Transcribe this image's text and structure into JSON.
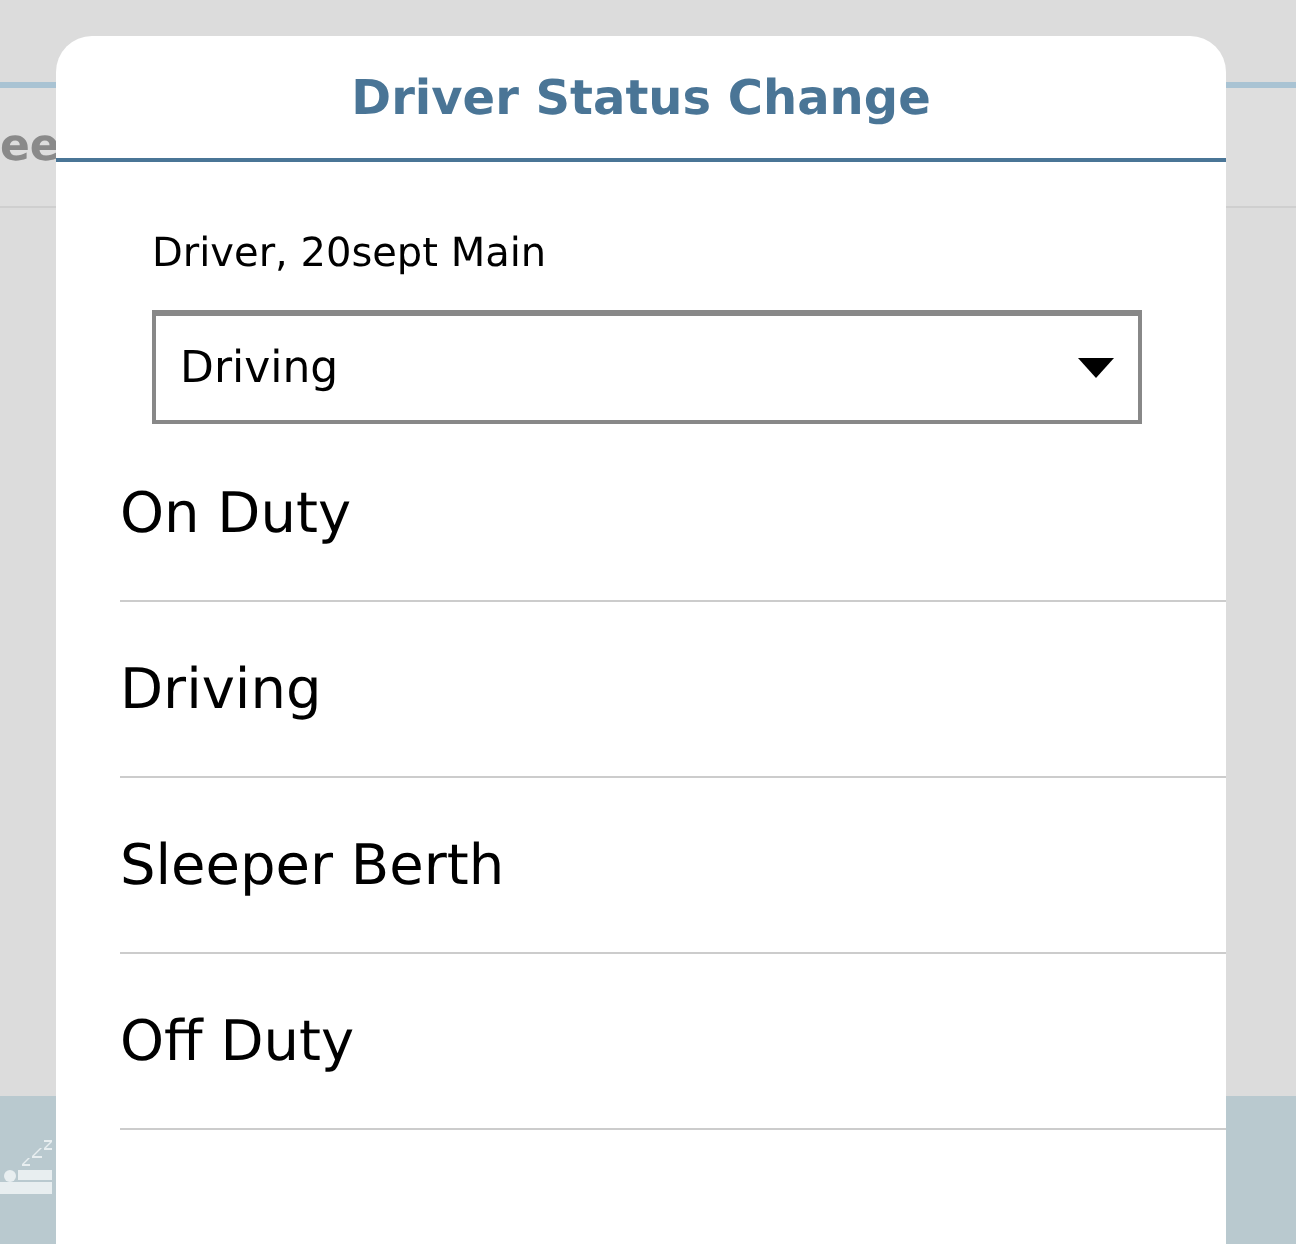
{
  "background": {
    "partial_text": "ee"
  },
  "dialog": {
    "title": "Driver Status Change",
    "driver_label": "Driver, 20sept Main",
    "status_select": {
      "value": "Driving"
    },
    "options": [
      {
        "label": "On Duty"
      },
      {
        "label": "Driving"
      },
      {
        "label": "Sleeper Berth"
      },
      {
        "label": "Off Duty"
      }
    ]
  }
}
